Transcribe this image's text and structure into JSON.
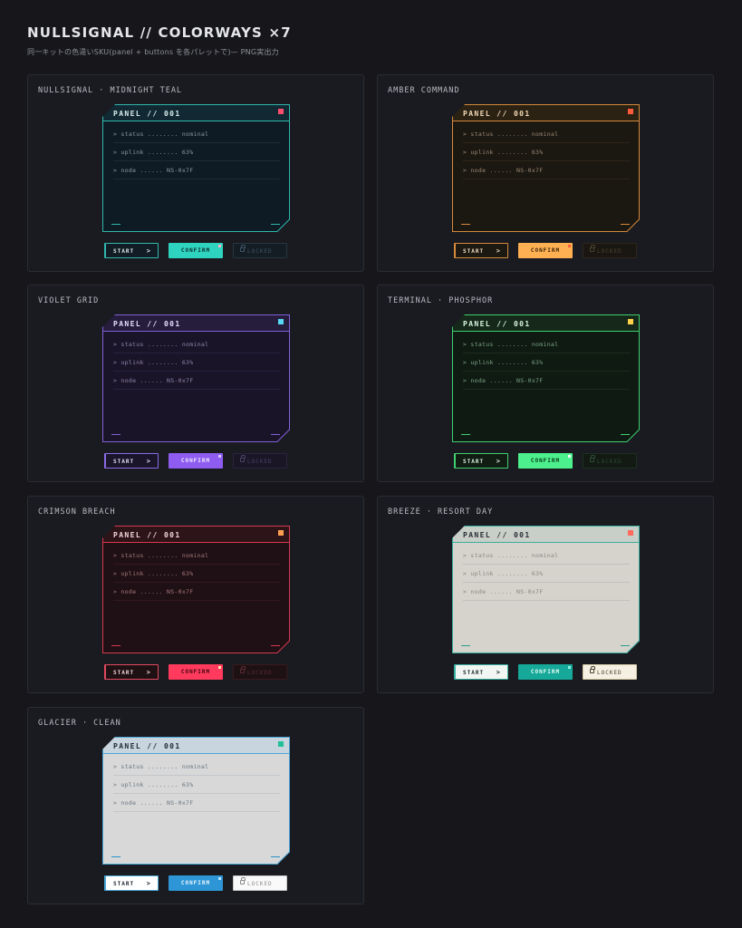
{
  "page": {
    "title": "NULLSIGNAL // COLORWAYS ×7",
    "subtitle": "同一キットの色違いSKU(panel + buttons を各パレットで)— PNG実出力"
  },
  "cards": [
    {
      "name": "NULLSIGNAL · MIDNIGHT TEAL",
      "theme": "teal",
      "panel": {
        "title": "PANEL // 001",
        "lines": [
          "> status ........ nominal",
          "> uplink ........ 63%",
          "> node ...... NS-0x7F"
        ]
      },
      "buttons": {
        "start": "START",
        "start_arrow": ">",
        "confirm": "CONFIRM",
        "locked": "LOCKED"
      }
    },
    {
      "name": "AMBER COMMAND",
      "theme": "amber",
      "panel": {
        "title": "PANEL // 001",
        "lines": [
          "> status ........ nominal",
          "> uplink ........ 63%",
          "> node ...... NS-0x7F"
        ]
      },
      "buttons": {
        "start": "START",
        "start_arrow": ">",
        "confirm": "CONFIRM",
        "locked": "LOCKED"
      }
    },
    {
      "name": "VIOLET GRID",
      "theme": "violet",
      "panel": {
        "title": "PANEL // 001",
        "lines": [
          "> status ........ nominal",
          "> uplink ........ 63%",
          "> node ...... NS-0x7F"
        ]
      },
      "buttons": {
        "start": "START",
        "start_arrow": ">",
        "confirm": "CONFIRM",
        "locked": "LOCKED"
      }
    },
    {
      "name": "TERMINAL · PHOSPHOR",
      "theme": "phosphor",
      "panel": {
        "title": "PANEL // 001",
        "lines": [
          "> status ........ nominal",
          "> uplink ........ 63%",
          "> node ...... NS-0x7F"
        ]
      },
      "buttons": {
        "start": "START",
        "start_arrow": ">",
        "confirm": "CONFIRM",
        "locked": "LOCKED"
      }
    },
    {
      "name": "CRIMSON BREACH",
      "theme": "crimson",
      "panel": {
        "title": "PANEL // 001",
        "lines": [
          "> status ........ nominal",
          "> uplink ........ 63%",
          "> node ...... NS-0x7F"
        ]
      },
      "buttons": {
        "start": "START",
        "start_arrow": ">",
        "confirm": "CONFIRM",
        "locked": "LOCKED"
      }
    },
    {
      "name": "BREEZE · RESORT DAY",
      "theme": "breeze",
      "panel": {
        "title": "PANEL // 001",
        "lines": [
          "> status ........ nominal",
          "> uplink ........ 63%",
          "> node ...... NS-0x7F"
        ]
      },
      "buttons": {
        "start": "START",
        "start_arrow": ">",
        "confirm": "CONFIRM",
        "locked": "LOCKED"
      }
    },
    {
      "name": "GLACIER · CLEAN",
      "theme": "glacier",
      "panel": {
        "title": "PANEL // 001",
        "lines": [
          "> status ........ nominal",
          "> uplink ........ 63%",
          "> node ...... NS-0x7F"
        ]
      },
      "buttons": {
        "start": "START",
        "start_arrow": ">",
        "confirm": "CONFIRM",
        "locked": "LOCKED"
      }
    }
  ],
  "theme_colors": {
    "teal": "#2fd4c0",
    "amber": "#ffb052",
    "violet": "#8e5cf0",
    "phosphor": "#4cf08c",
    "crimson": "#ff3a5c",
    "breeze": "#16a898",
    "glacier": "#2e96d6"
  }
}
